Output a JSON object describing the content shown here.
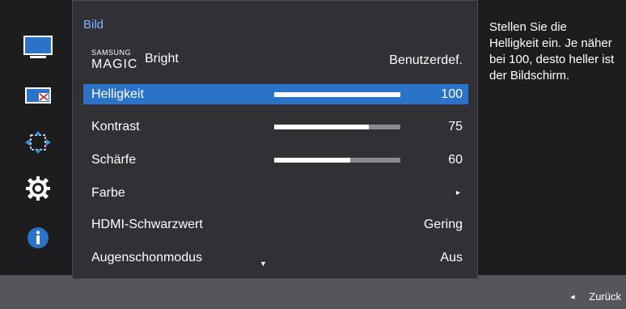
{
  "menu": {
    "title": "Bild",
    "magic": {
      "brand_small": "SAMSUNG",
      "brand_big": "MAGIC",
      "suffix": "Bright",
      "value": "Benutzerdef."
    },
    "rows": [
      {
        "label": "Helligkeit",
        "value": "100",
        "level": 1.0,
        "selected": true
      },
      {
        "label": "Kontrast",
        "value": "75",
        "level": 0.75
      },
      {
        "label": "Schärfe",
        "value": "60",
        "level": 0.6
      },
      {
        "label": "Farbe",
        "arrow": "▸"
      },
      {
        "label": "HDMI-Schwarzwert",
        "value": "Gering"
      },
      {
        "label": "Augenschonmodus",
        "value": "Aus"
      }
    ],
    "scroll_indicator": "▼"
  },
  "info": {
    "text": "Stellen Sie die Helligkeit ein. Je näher bei 100, desto heller ist der Bildschirm."
  },
  "footer": {
    "back_label": "Zurück",
    "back_icon": "◄"
  },
  "icons": [
    "monitor-icon",
    "picture-in-picture-icon",
    "resize-arrows-icon",
    "gear-icon",
    "info-icon"
  ],
  "colors": {
    "accent": "#2a73c8",
    "title": "#7fb7ff",
    "panel": "#303035",
    "rail": "#1d1d20"
  }
}
